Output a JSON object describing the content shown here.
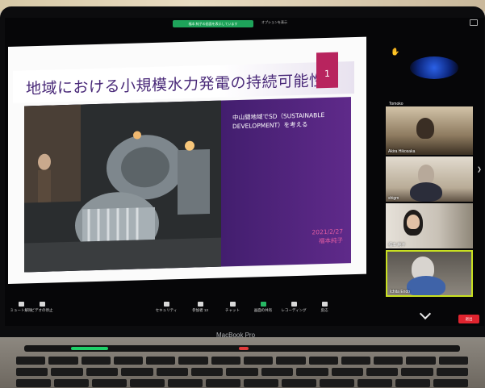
{
  "window": {
    "share_bar_text": "福本 純子の画面を表示しています",
    "view_options": "オプションを表示"
  },
  "slide": {
    "title": "地域における小規模水力発電の持続可能性",
    "number": "1",
    "subtitle_line1": "中山間地域でSD（SUSTAINABLE",
    "subtitle_line2": "DEVELOPMENT）を考える",
    "date": "2021/2/27",
    "author": "福本純子"
  },
  "participants": {
    "top_label": "Tomoko",
    "tiles": [
      {
        "name": "Akira Hikosaka"
      },
      {
        "name": "shigm"
      },
      {
        "name": "福本 純子"
      },
      {
        "name": "Ichita Endo"
      }
    ]
  },
  "toolbar": {
    "mute": "ミュート解除",
    "video": "ビデオの停止",
    "security": "セキュリティ",
    "participants": "参加者",
    "participants_count": "13",
    "chat": "チャット",
    "share": "画面の共有",
    "record": "レコーディング",
    "reactions": "反応",
    "end": "退出"
  },
  "device": {
    "brand": "MacBook Pro"
  },
  "colors": {
    "slide_title": "#4a2a79",
    "accent_pink": "#b8245e",
    "share_green": "#1ea35a",
    "end_red": "#e0242f",
    "active_speaker": "#c8e020"
  }
}
